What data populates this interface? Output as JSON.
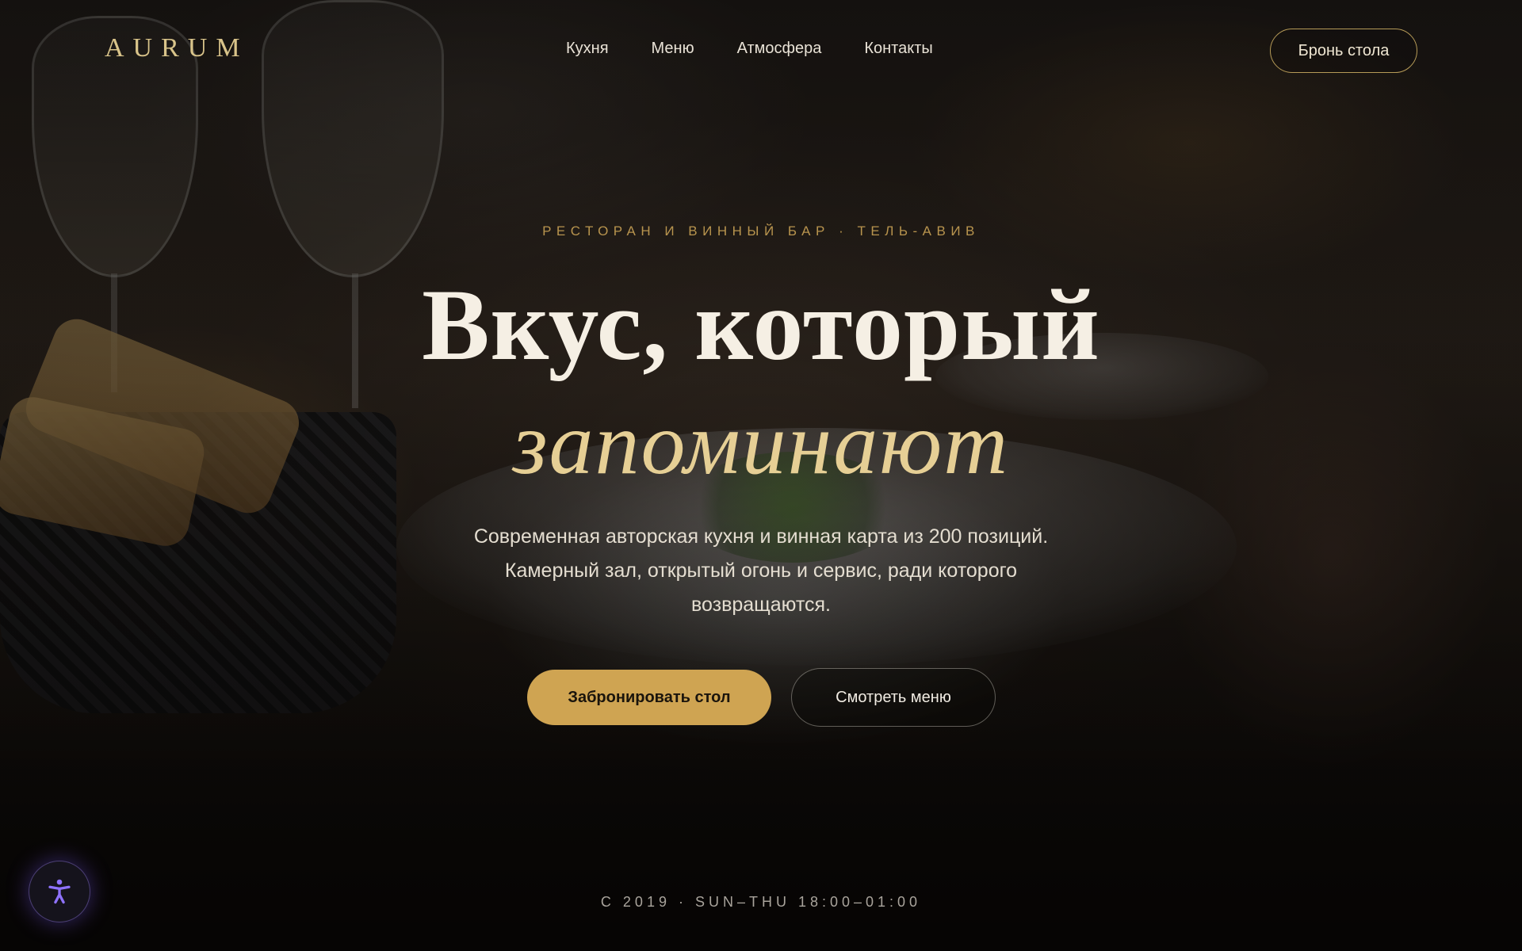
{
  "brand": {
    "logo": "AURUM"
  },
  "nav": {
    "items": [
      {
        "label": "Кухня"
      },
      {
        "label": "Меню"
      },
      {
        "label": "Атмосфера"
      },
      {
        "label": "Контакты"
      }
    ],
    "reserve_label": "Бронь стола"
  },
  "hero": {
    "eyebrow": "РЕСТОРАН И ВИННЫЙ БАР · ТЕЛЬ-АВИВ",
    "title_line1": "Вкус, который",
    "title_line2": "запоминают",
    "lead_line1": "Современная авторская кухня и винная карта из 200 позиций.",
    "lead_line2": "Камерный зал, открытый огонь и сервис, ради которого",
    "lead_line3": "возвращаются.",
    "primary_cta": "Забронировать стол",
    "secondary_cta": "Смотреть меню"
  },
  "footer": {
    "hours": "С 2019 · SUN–THU 18:00–01:00"
  },
  "accessibility": {
    "icon": "accessibility-icon"
  },
  "colors": {
    "accent_gold": "#cfa452",
    "logo_gold": "#d9c48a",
    "title_italic": "#e6cf95",
    "a11y_glow": "#6e50dc"
  }
}
